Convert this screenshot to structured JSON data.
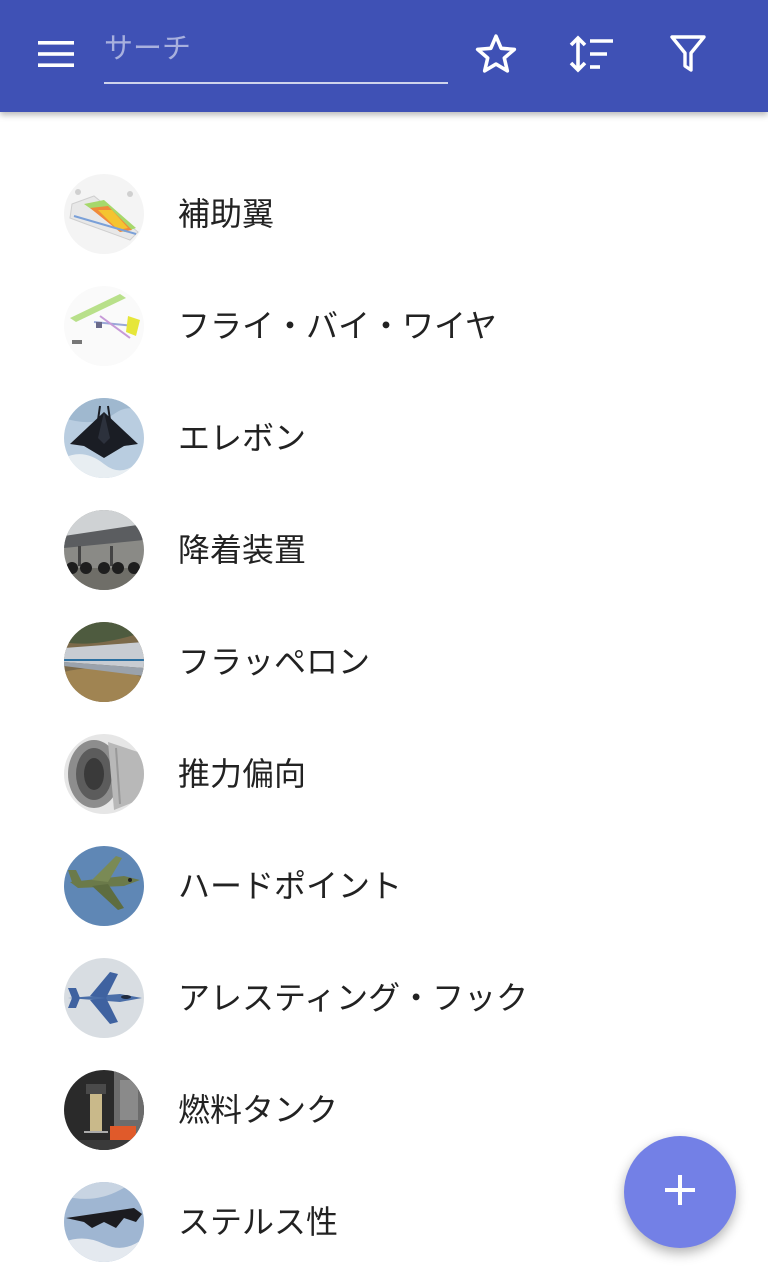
{
  "toolbar": {
    "menu_icon": "hamburger-menu-icon",
    "search_placeholder": "サーチ",
    "search_value": "",
    "favorites_icon": "star-outline-icon",
    "sort_icon": "sort-icon",
    "filter_icon": "filter-icon",
    "color": "#3f51b5"
  },
  "items": [
    {
      "label": "補助翼",
      "thumb": "aileron-diagram"
    },
    {
      "label": "フライ・バイ・ワイヤ",
      "thumb": "fly-by-wire-diagram"
    },
    {
      "label": "エレボン",
      "thumb": "stealth-fighter-photo"
    },
    {
      "label": "降着装置",
      "thumb": "landing-gear-photo"
    },
    {
      "label": "フラッペロン",
      "thumb": "wing-flap-photo"
    },
    {
      "label": "推力偏向",
      "thumb": "nozzle-photo"
    },
    {
      "label": "ハードポイント",
      "thumb": "attack-jet-photo"
    },
    {
      "label": "アレスティング・フック",
      "thumb": "fighter-jet-photo"
    },
    {
      "label": "燃料タンク",
      "thumb": "fuel-tank-photo"
    },
    {
      "label": "ステルス性",
      "thumb": "stealth-bomber-photo"
    }
  ],
  "fab": {
    "icon": "plus-icon",
    "color": "#7380e6"
  }
}
